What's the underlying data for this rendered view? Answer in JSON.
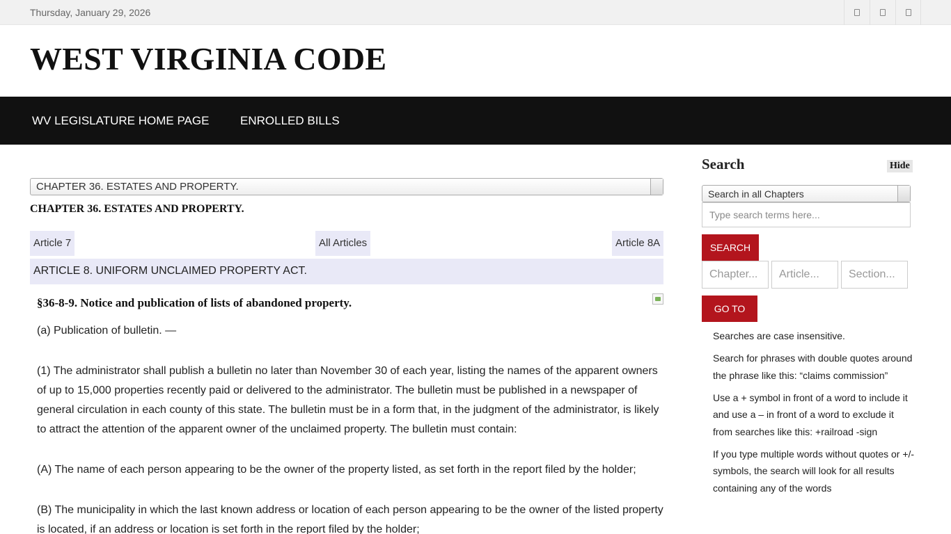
{
  "topbar": {
    "date": "Thursday, January 29, 2026",
    "social_icons": [
      "social-icon-1",
      "social-icon-2",
      "social-icon-3"
    ]
  },
  "header": {
    "title": "WEST VIRGINIA CODE"
  },
  "nav": {
    "items": [
      {
        "label": "WV LEGISLATURE HOME PAGE"
      },
      {
        "label": "ENROLLED BILLS"
      }
    ]
  },
  "main": {
    "chapter_select": "CHAPTER 36. ESTATES AND PROPERTY.",
    "chapter_heading": "CHAPTER 36. ESTATES AND PROPERTY.",
    "article_nav": {
      "prev": "Article 7",
      "all": "All Articles",
      "next": "Article 8A"
    },
    "article_title": "ARTICLE 8. UNIFORM UNCLAIMED PROPERTY ACT.",
    "section_title": "§36-8-9. Notice and publication of lists of abandoned property.",
    "paragraphs": [
      "(a) Publication of bulletin. —",
      "(1) The administrator shall publish a bulletin no later than November 30 of each year, listing the names of the apparent owners of up to 15,000 properties recently paid or delivered to the administrator. The bulletin must be published in a newspaper of general circulation in each county of this state. The bulletin must be in a form that, in the judgment of the administrator, is likely to attract the attention of the apparent owner of the unclaimed property. The bulletin must contain:",
      "(A) The name of each person appearing to be the owner of the property listed, as set forth in the report filed by the holder;",
      "(B) The municipality in which the last known address or location of each person appearing to be the owner of the listed property is located, if an address or location is set forth in the report filed by the holder;"
    ]
  },
  "sidebar": {
    "title": "Search",
    "hide_label": "Hide",
    "scope_select": "Search in all Chapters",
    "search_placeholder": "Type search terms here...",
    "search_button": "SEARCH",
    "chapter_placeholder": "Chapter...",
    "article_placeholder": "Article...",
    "section_placeholder": "Section...",
    "goto_button": "GO TO",
    "tips": [
      "Searches are case insensitive.",
      "Search for phrases with double quotes around the phrase like this: “claims commission”",
      "Use a + symbol in front of a word to include it and use a – in front of a word to exclude it from searches like this: +railroad -sign",
      "If you type multiple words without quotes or +/- symbols, the search will look for all results containing any of the words"
    ]
  },
  "colors": {
    "nav_bg": "#111111",
    "accent_red": "#b3151d",
    "article_bg": "#e9e9f7"
  }
}
